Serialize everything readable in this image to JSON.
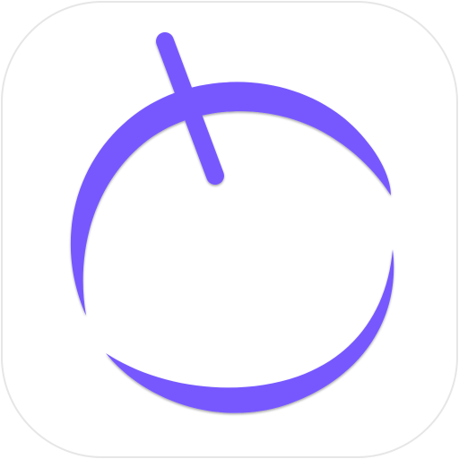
{
  "icon": {
    "name": "power-timer-app-icon",
    "tile_color": "#ffffff",
    "tile_border_color": "#e6e6e6",
    "accent_color": "#7758ff",
    "shadow_color": "#4a3b8f"
  }
}
